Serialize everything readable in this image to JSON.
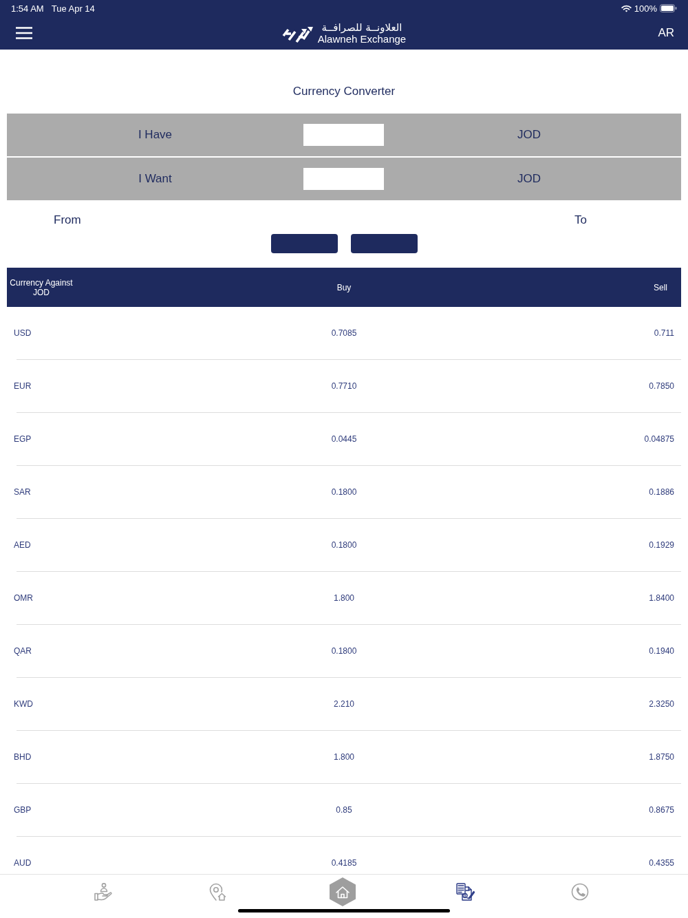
{
  "status_bar": {
    "time": "1:54 AM",
    "date": "Tue Apr 14",
    "battery": "100%"
  },
  "header": {
    "logo_arabic": "العلاونــة للصرافــة",
    "logo_name": "Alawneh Exchange",
    "language_button": "AR"
  },
  "converter": {
    "title": "Currency Converter",
    "rows": [
      {
        "label": "I Have",
        "currency": "JOD"
      },
      {
        "label": "I Want",
        "currency": "JOD"
      }
    ],
    "from_label": "From",
    "to_label": "To"
  },
  "rates_table": {
    "columns": [
      "Currency Against JOD",
      "Buy",
      "Sell"
    ],
    "rows": [
      {
        "currency": "USD",
        "buy": "0.7085",
        "sell": "0.711"
      },
      {
        "currency": "EUR",
        "buy": "0.7710",
        "sell": "0.7850"
      },
      {
        "currency": "EGP",
        "buy": "0.0445",
        "sell": "0.04875"
      },
      {
        "currency": "SAR",
        "buy": "0.1800",
        "sell": "0.1886"
      },
      {
        "currency": "AED",
        "buy": "0.1800",
        "sell": "0.1929"
      },
      {
        "currency": "OMR",
        "buy": "1.800",
        "sell": "1.8400"
      },
      {
        "currency": "QAR",
        "buy": "0.1800",
        "sell": "0.1940"
      },
      {
        "currency": "KWD",
        "buy": "2.210",
        "sell": "2.3250"
      },
      {
        "currency": "BHD",
        "buy": "1.800",
        "sell": "1.8750"
      },
      {
        "currency": "GBP",
        "buy": "0.85",
        "sell": "0.8675"
      },
      {
        "currency": "AUD",
        "buy": "0.4185",
        "sell": "0.4355"
      }
    ]
  },
  "tab_bar": {
    "items": [
      {
        "kind": "plain",
        "selected": false
      },
      {
        "kind": "plain",
        "selected": false
      },
      {
        "kind": "hexagon",
        "selected": false
      },
      {
        "kind": "plain",
        "selected": true
      },
      {
        "kind": "plain",
        "selected": false
      }
    ]
  }
}
